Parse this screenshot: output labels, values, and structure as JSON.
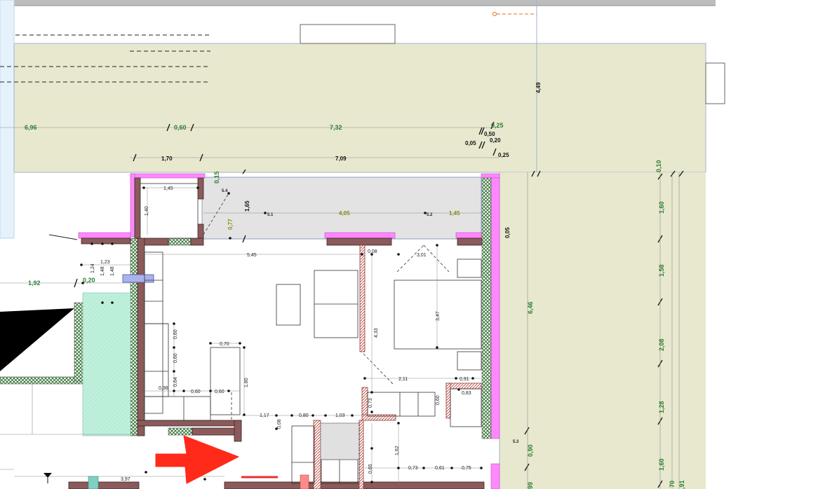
{
  "colors": {
    "terrace": "#e8e8cf",
    "wall_fill": "#8b5a5a",
    "hatch_green": "#3b7f3b",
    "magenta": "#ff80ff",
    "balcony_grey": "#e3e3e3",
    "teal_area": "#b8ecd8",
    "left_panel": "#e6f2fb",
    "arrow_red": "#ff2a1a",
    "dim_green": "#2e7d32"
  },
  "dimensions": {
    "top_696": "6,96",
    "top_060": "0,60",
    "top_732": "7,32",
    "top_025a": "0,25",
    "top_050": "0,50",
    "top_005": "0,05",
    "top_020": "0,20",
    "row2_170": "1,70",
    "row2_709": "7,09",
    "row2_025b": "0,25",
    "vert_449": "4,49",
    "right_010": "0,10",
    "b145": "1,45",
    "b140": "1,40",
    "b015": "0,15",
    "b165": "1,65",
    "b077": "0,77",
    "b405": "4,05",
    "b145b": "1,45",
    "label_54": "5.4",
    "label_51": "5.1",
    "label_52": "5.2",
    "w005": "0,05",
    "i545": "5,45",
    "i008": "0,08",
    "i301": "3,01",
    "l123": "1,23",
    "l124": "1,24",
    "l148a": "1,48",
    "l148b": "1,48",
    "l192": "1,92",
    "l020": "0,20",
    "i347": "3,47",
    "i433": "4,33",
    "i060a": "0,60",
    "i060b": "0,60",
    "i064": "0,64",
    "i070": "0,70",
    "i180": "1,80",
    "i036": "0,36",
    "i060c": "0,60",
    "i060d": "0,60",
    "i211": "2,11",
    "i091": "0,91",
    "i083": "0,83",
    "i073": "0,73",
    "i060e": "0,60",
    "i117": "1,17",
    "i080": "0,80",
    "i103": "1,03",
    "i008b": "0,08",
    "i162": "1,62",
    "i073b": "0,73",
    "i061": "0,61",
    "i075": "0,75",
    "i065": "0,65",
    "b397": "3,97",
    "label_53": "5.3",
    "r646": "6,46",
    "r090": "0,90",
    "r099": "99",
    "f160a": "1,60",
    "f158": "1,58",
    "f208": "2,08",
    "f128": "1,28",
    "f160b": "1,60",
    "f070": "70",
    "f091": ",91"
  }
}
